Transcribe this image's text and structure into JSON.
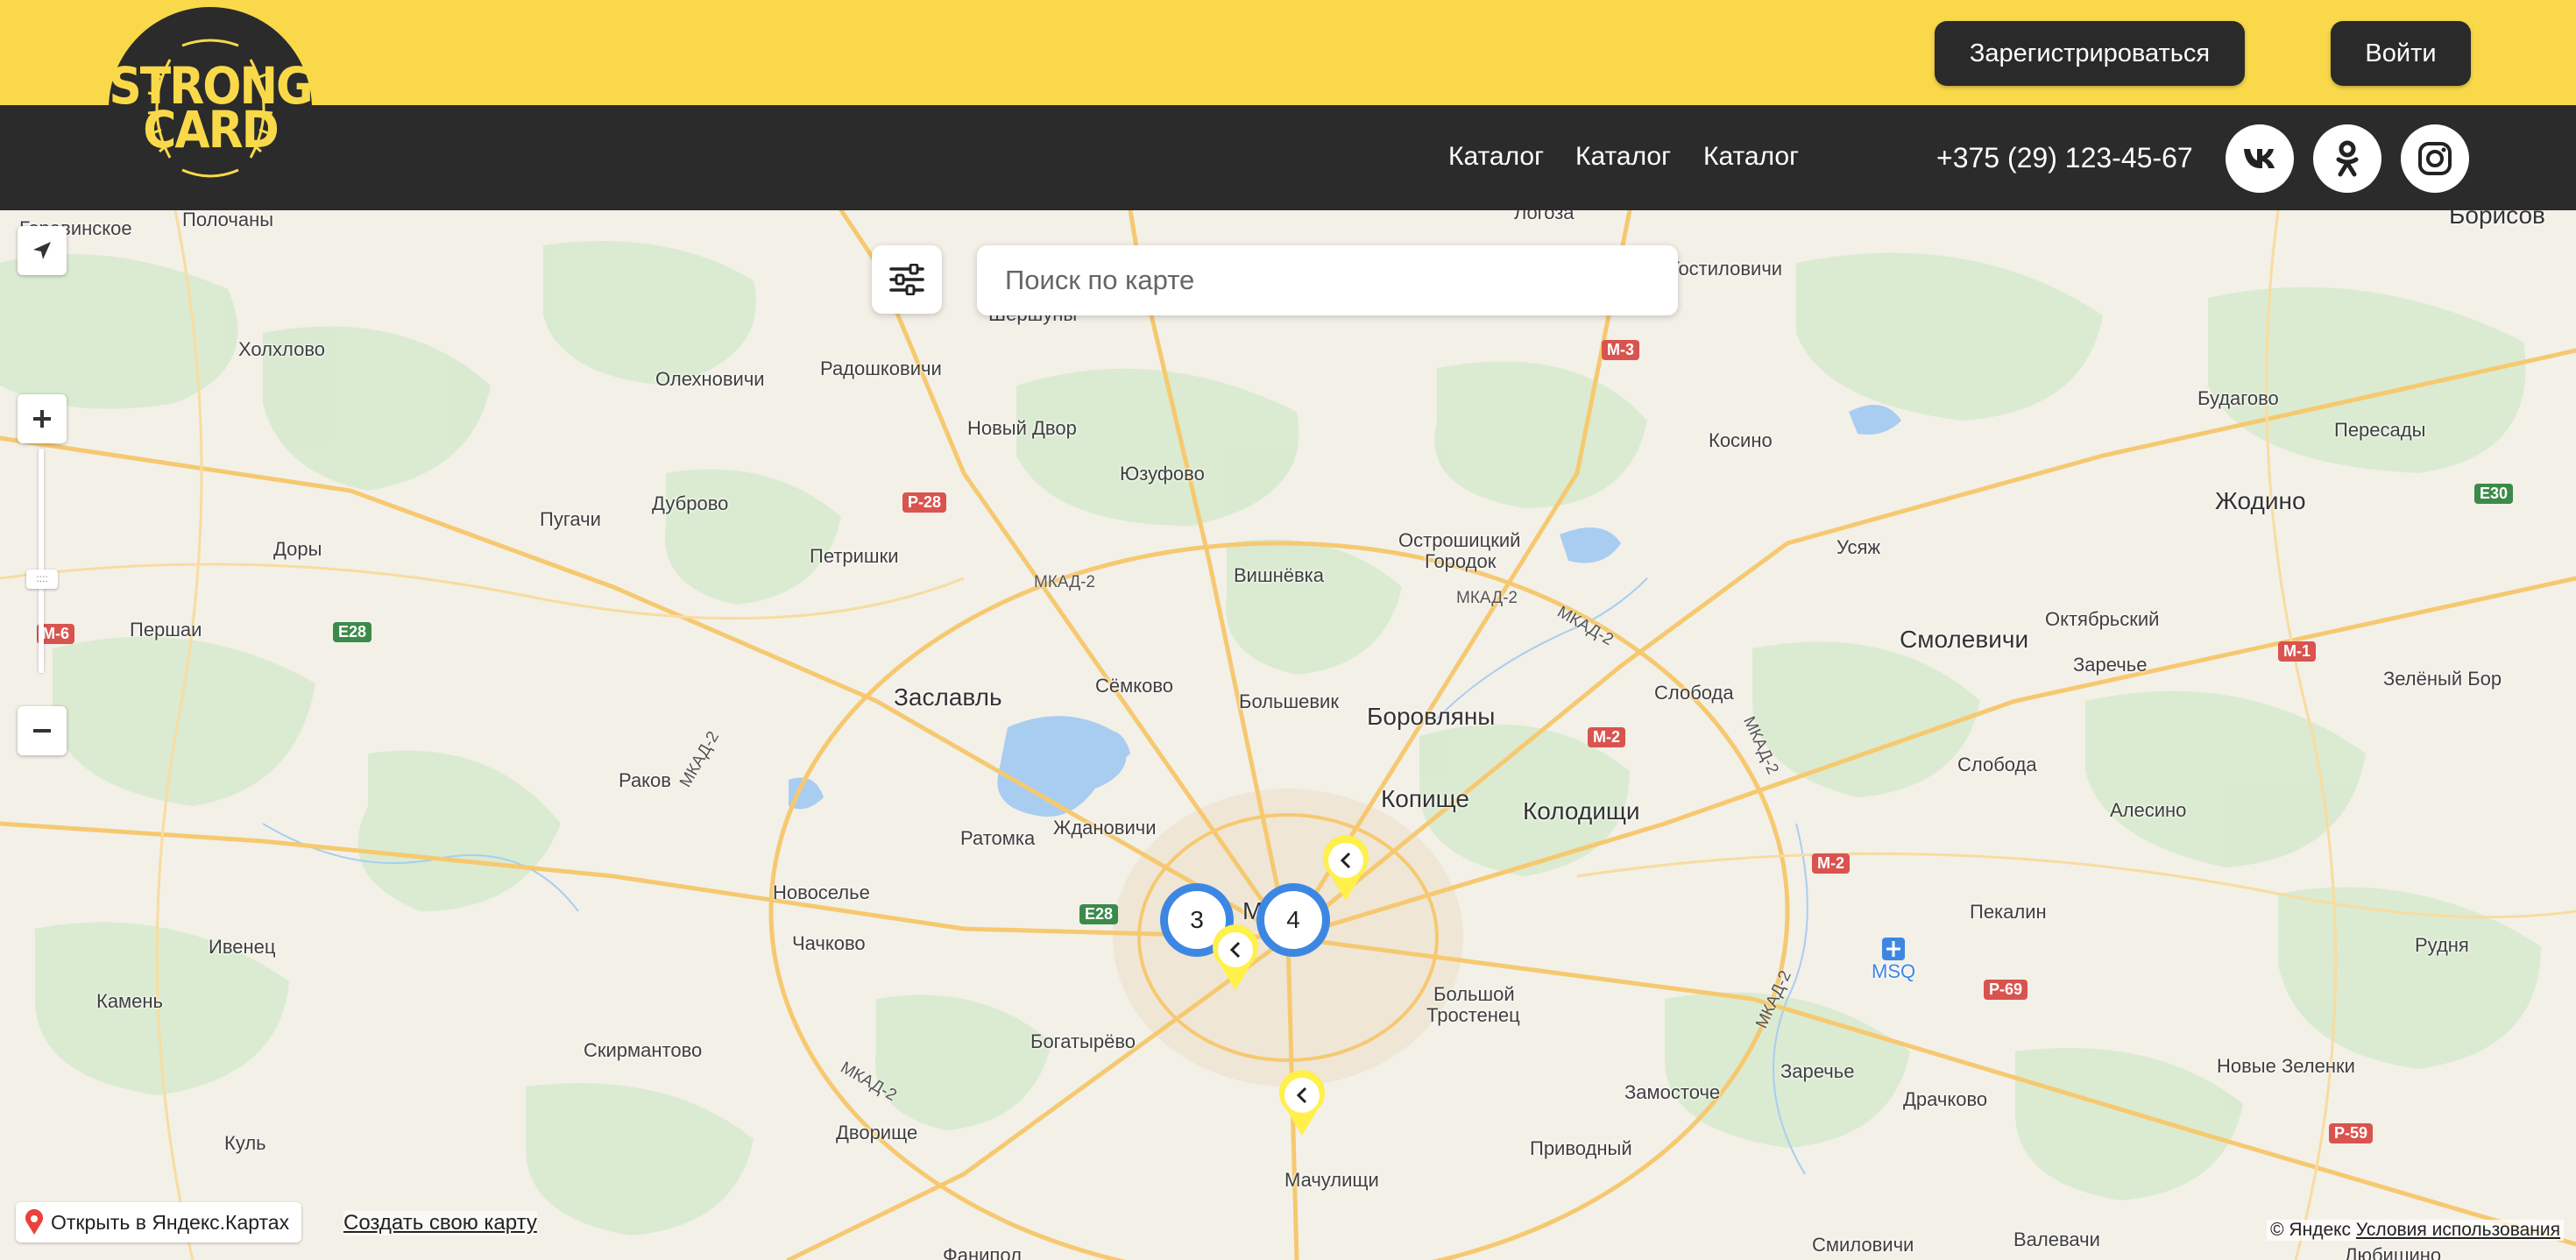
{
  "header": {
    "register_label": "Зарегистрироваться",
    "login_label": "Войти",
    "logo": {
      "line1": "STRONG",
      "line2": "CARD"
    },
    "nav": [
      {
        "label": "Каталог"
      },
      {
        "label": "Каталог"
      },
      {
        "label": "Каталог"
      }
    ],
    "phone": "+375 (29) 123-45-67",
    "social": [
      "vk-icon",
      "odnoklassniki-icon",
      "instagram-icon"
    ]
  },
  "map": {
    "search_placeholder": "Поиск по карте",
    "clusters": [
      {
        "count": "3"
      },
      {
        "count": "4"
      }
    ],
    "places": {
      "p1": "Гостиловичи",
      "p2": "Логоза",
      "p3": "Борисов",
      "p4": "Полочаны",
      "p5": "Холхлово",
      "p6": "Радошковичи",
      "p7": "Олехновичи",
      "p8": "Новый Двор",
      "p9": "Юзуфово",
      "p10": "Дуброво",
      "p11": "Пугачи",
      "p12": "Доры",
      "p13": "Першаи",
      "p14": "Петришки",
      "p15": "Вишнёвка",
      "p16": "Остро­шицкий",
      "p17": "Городок",
      "p18": "Косино",
      "p19": "Будагово",
      "p20": "Пересады",
      "p21": "Жодино",
      "p22": "Усяж",
      "p23": "Смолевичи",
      "p24": "Октябрьский",
      "p25": "Заречье",
      "p26": "Зелёный Бор",
      "p27": "Сёмково",
      "p28": "Заславль",
      "p29": "Большевик",
      "p30": "Боровляны",
      "p31": "Слобода",
      "p32": "Копище",
      "p33": "Колодищи",
      "p34": "Раков",
      "p35": "Ратомка",
      "p36": "Ждановичи",
      "p37": "Новоселье",
      "p38": "Чачково",
      "p39": "Ивенец",
      "p40": "Камень",
      "p41": "Скирмантово",
      "p42": "Богатырёво",
      "p43": "Большой",
      "p44": "Тростенец",
      "p45": "Алесино",
      "p46": "Слобода",
      "p47": "Пекалин",
      "p48": "Рудня",
      "p49": "MSQ",
      "p50": "Заречье",
      "p51": "Новые Зеленки",
      "p52": "Замосточе",
      "p53": "Драчково",
      "p54": "Приводный",
      "p55": "Дворище",
      "p56": "Мачулищи",
      "p57": "Куль",
      "p58": "Смиловичи",
      "p59": "Валевачи",
      "p60": "Шершуны",
      "p61": "Горавинское",
      "p62": "Минск",
      "p63": "Любишино",
      "p64": "Фанипол"
    },
    "roads": {
      "r1": "М-3",
      "r2": "Р-28",
      "r3": "Е28",
      "r4": "М-6",
      "r5": "М-2",
      "r6": "М-1",
      "r7": "Е30",
      "r8": "Е28",
      "r9": "М-2",
      "r10": "Р-69",
      "r11": "Р-59"
    },
    "mkad_label": "МКАД-2",
    "open_yandex_label": "Открыть в Яндекс.Картах",
    "create_map_label": "Создать свою карту",
    "copyright": "© Яндекс",
    "terms_label": "Условия использования"
  },
  "colors": {
    "accent_yellow": "#f9d94a",
    "dark": "#2b2b2b",
    "cluster_blue": "#3d87e3",
    "pin_yellow": "#fff04a"
  }
}
